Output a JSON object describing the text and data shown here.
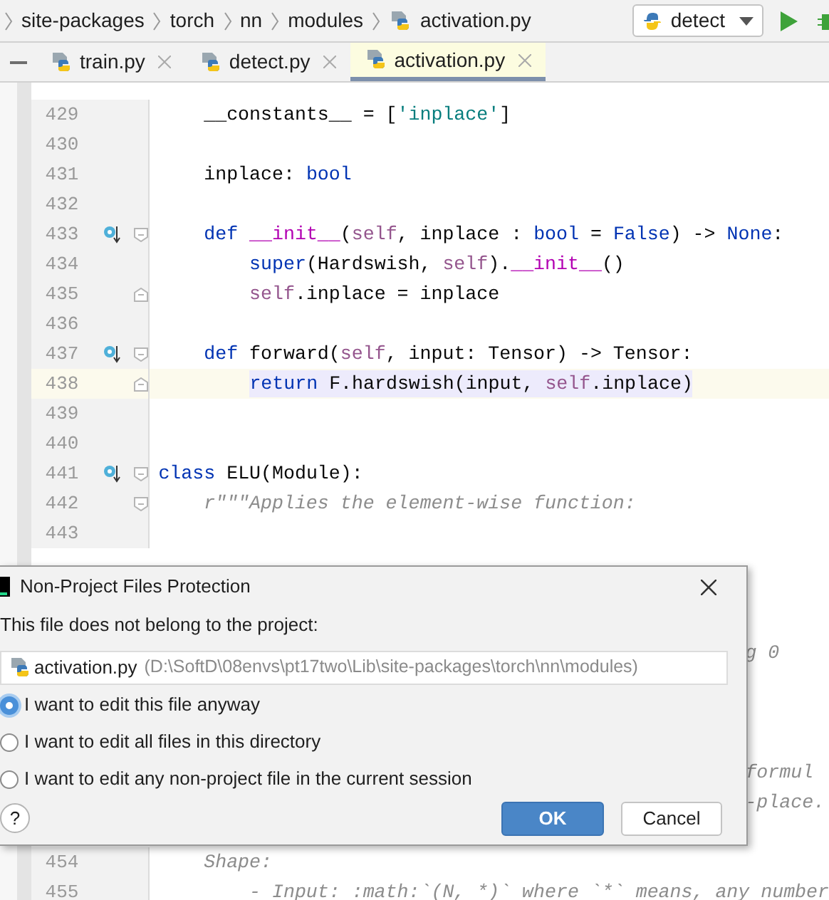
{
  "breadcrumbs": [
    {
      "label": "site-packages",
      "kind": "folder"
    },
    {
      "label": "torch",
      "kind": "folder"
    },
    {
      "label": "nn",
      "kind": "folder"
    },
    {
      "label": "modules",
      "kind": "folder"
    },
    {
      "label": "activation.py",
      "kind": "file"
    }
  ],
  "run_config": {
    "label": "detect"
  },
  "tabs": [
    {
      "label": "train.py",
      "selected": false
    },
    {
      "label": "detect.py",
      "selected": false
    },
    {
      "label": "activation.py",
      "selected": true
    }
  ],
  "editor": {
    "lines": [
      {
        "kind": "code",
        "number": "429",
        "tokens": [
          {
            "t": "    __constants__ = [",
            "kind": "plain"
          },
          {
            "t": "'inplace'",
            "kind": "str"
          },
          {
            "t": "]",
            "kind": "plain"
          }
        ]
      },
      {
        "kind": "code",
        "number": "430"
      },
      {
        "kind": "code",
        "number": "431",
        "tokens": [
          {
            "t": "    inplace: ",
            "kind": "plain"
          },
          {
            "t": "bool",
            "kind": "kw"
          }
        ]
      },
      {
        "kind": "code",
        "number": "432"
      },
      {
        "kind": "code",
        "number": "433",
        "override": true,
        "fold_open": true,
        "tokens": [
          {
            "t": "    def",
            "kind": "kw"
          },
          {
            "t": " __init__",
            "kind": "magic"
          },
          {
            "t": "(",
            "kind": "plain"
          },
          {
            "t": "self",
            "kind": "self"
          },
          {
            "t": ", inplace : ",
            "kind": "plain"
          },
          {
            "t": "bool",
            "kind": "kw"
          },
          {
            "t": " = ",
            "kind": "plain"
          },
          {
            "t": "False",
            "kind": "kw"
          },
          {
            "t": ") -> ",
            "kind": "plain"
          },
          {
            "t": "None",
            "kind": "kw"
          },
          {
            "t": ":",
            "kind": "plain"
          }
        ]
      },
      {
        "kind": "code",
        "number": "434",
        "tokens": [
          {
            "t": "        super",
            "kind": "kw"
          },
          {
            "t": "(Hardswish, ",
            "kind": "plain"
          },
          {
            "t": "self",
            "kind": "self"
          },
          {
            "t": ").",
            "kind": "plain"
          },
          {
            "t": "__init__",
            "kind": "magic"
          },
          {
            "t": "()",
            "kind": "plain"
          }
        ]
      },
      {
        "kind": "code",
        "number": "435",
        "fold_close": true,
        "tokens": [
          {
            "t": "        self",
            "kind": "self"
          },
          {
            "t": ".inplace = inplace",
            "kind": "plain"
          }
        ]
      },
      {
        "kind": "code",
        "number": "436"
      },
      {
        "kind": "code",
        "number": "437",
        "override": true,
        "fold_open": true,
        "tokens": [
          {
            "t": "    def",
            "kind": "kw"
          },
          {
            "t": " forward(",
            "kind": "plain"
          },
          {
            "t": "self",
            "kind": "self"
          },
          {
            "t": ", input: Tensor) -> Tensor:",
            "kind": "plain"
          }
        ]
      },
      {
        "kind": "code",
        "number": "438",
        "current": true,
        "fold_close": true,
        "tokens": [
          {
            "t": "return",
            "kind": "kw"
          },
          {
            "t": " F.hardswish(input, ",
            "kind": "plain"
          },
          {
            "t": "self",
            "kind": "self"
          },
          {
            "t": ".inplace)",
            "kind": "plain"
          }
        ]
      },
      {
        "kind": "code",
        "number": "439"
      },
      {
        "kind": "code",
        "number": "440"
      },
      {
        "kind": "code",
        "number": "441",
        "override": true,
        "fold_open": true,
        "tokens": [
          {
            "t": "class",
            "kind": "kw"
          },
          {
            "t": " ELU(Module):",
            "kind": "plain"
          }
        ]
      },
      {
        "kind": "code",
        "number": "442",
        "fold_open": true,
        "tokens": [
          {
            "t": "    r\"\"\"Applies the element-wise function:",
            "kind": "doc"
          }
        ]
      },
      {
        "kind": "code",
        "number": "443"
      },
      {
        "kind": "covered"
      },
      {
        "kind": "covered"
      },
      {
        "kind": "covered"
      },
      {
        "kind": "covered",
        "tail": "g 0"
      },
      {
        "kind": "covered"
      },
      {
        "kind": "covered"
      },
      {
        "kind": "covered"
      },
      {
        "kind": "covered",
        "tail": "formul"
      },
      {
        "kind": "covered",
        "tail": "-place."
      },
      {
        "kind": "covered"
      },
      {
        "kind": "code",
        "number": "454",
        "tokens": [
          {
            "t": "    Shape:",
            "kind": "doc"
          }
        ]
      },
      {
        "kind": "code",
        "number": "455",
        "tokens": [
          {
            "t": "        - Input: :math:`(N, *)` where `*` means, any number",
            "kind": "doc"
          }
        ]
      }
    ]
  },
  "dialog": {
    "title": "Non-Project Files Protection",
    "message": "This file does not belong to the project:",
    "file": {
      "name": "activation.py",
      "path": "(D:\\SoftD\\08envs\\pt17two\\Lib\\site-packages\\torch\\nn\\modules)"
    },
    "options": [
      {
        "label": "I want to edit this file anyway",
        "selected": true
      },
      {
        "label": "I want to edit all files in this directory",
        "selected": false
      },
      {
        "label": "I want to edit any non-project file in the current session",
        "selected": false
      }
    ],
    "help": "?",
    "buttons": [
      {
        "label": "OK",
        "kind": "primary"
      },
      {
        "label": "Cancel",
        "kind": "secondary"
      }
    ]
  }
}
